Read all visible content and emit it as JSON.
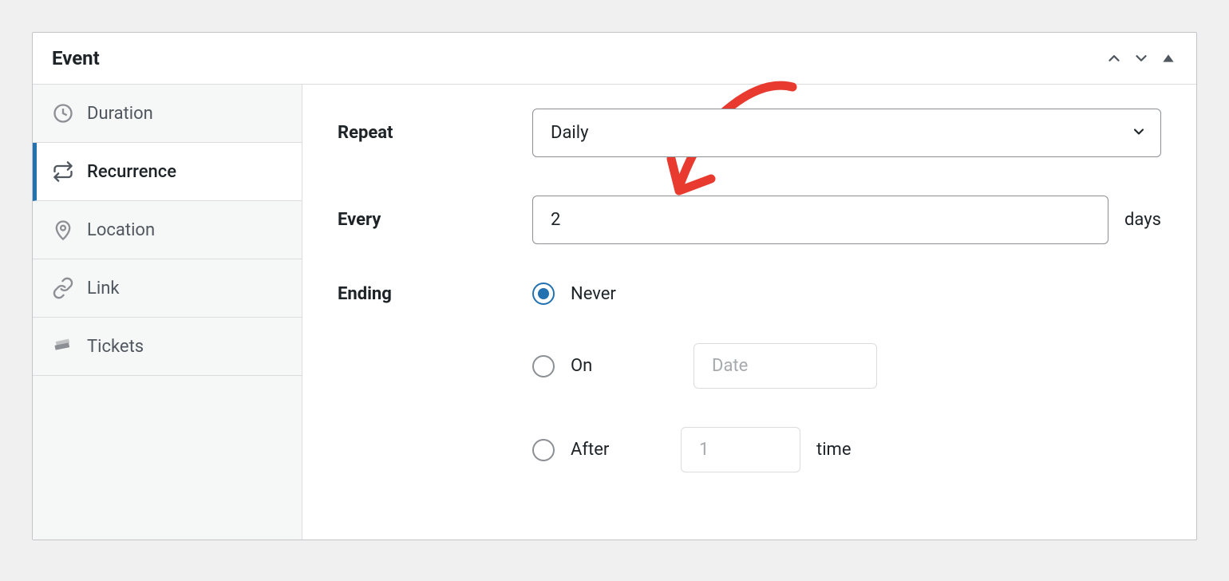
{
  "card": {
    "title": "Event"
  },
  "sidebar": {
    "items": [
      {
        "label": "Duration"
      },
      {
        "label": "Recurrence"
      },
      {
        "label": "Location"
      },
      {
        "label": "Link"
      },
      {
        "label": "Tickets"
      }
    ],
    "active_index": 1
  },
  "form": {
    "repeat": {
      "label": "Repeat",
      "value": "Daily"
    },
    "every": {
      "label": "Every",
      "value": "2",
      "suffix": "days"
    },
    "ending": {
      "label": "Ending",
      "selected": "never",
      "options": {
        "never": {
          "label": "Never"
        },
        "on": {
          "label": "On",
          "placeholder": "Date"
        },
        "after": {
          "label": "After",
          "placeholder": "1",
          "suffix": "time"
        }
      }
    }
  }
}
